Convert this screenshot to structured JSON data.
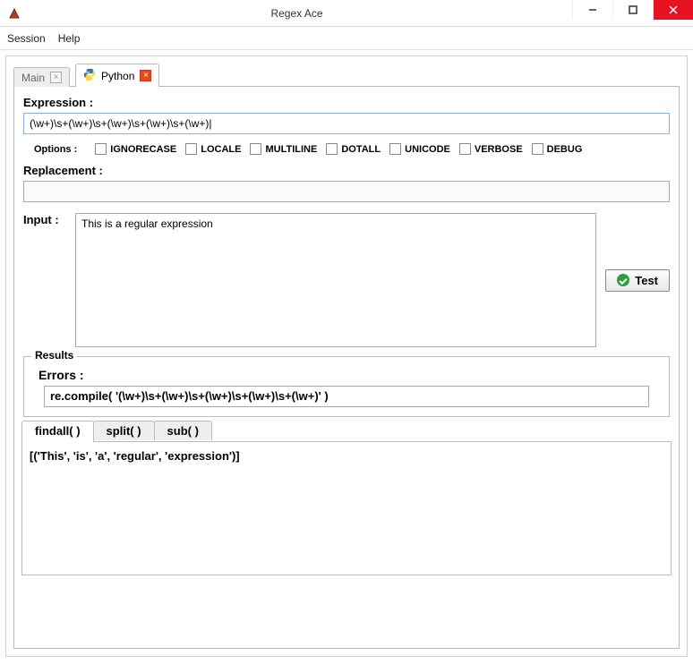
{
  "window": {
    "title": "Regex Ace"
  },
  "menubar": {
    "session": "Session",
    "help": "Help"
  },
  "tabs": {
    "main": "Main",
    "python": "Python"
  },
  "labels": {
    "expression": "Expression :",
    "options": "Options :",
    "replacement": "Replacement :",
    "input": "Input :",
    "results": "Results",
    "errors": "Errors :",
    "test_btn": "Test"
  },
  "expression_value": "(\\w+)\\s+(\\w+)\\s+(\\w+)\\s+(\\w+)\\s+(\\w+)|",
  "replacement_value": "",
  "input_value": "This is a regular expression",
  "options": {
    "ignorecase": "IGNORECASE",
    "locale": "LOCALE",
    "multiline": "MULTILINE",
    "dotall": "DOTALL",
    "unicode": "UNICODE",
    "verbose": "VERBOSE",
    "debug": "DEBUG"
  },
  "errors_value": "re.compile( '(\\w+)\\s+(\\w+)\\s+(\\w+)\\s+(\\w+)\\s+(\\w+)' )",
  "result_tabs": {
    "findall": "findall( )",
    "split": "split( )",
    "sub": "sub( )"
  },
  "result_value": "[('This', 'is', 'a', 'regular', 'expression')]"
}
